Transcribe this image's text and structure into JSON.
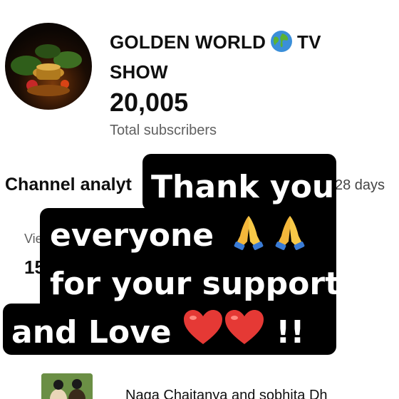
{
  "channel": {
    "name_part1": "GOLDEN WORLD",
    "name_part2": "TV",
    "name_line2": "SHOW",
    "subscriber_count": "20,005",
    "subscriber_label": "Total subscribers"
  },
  "analytics": {
    "title": "Channel analyt",
    "period": "28 days",
    "views_label": "Vie",
    "views_value": "15"
  },
  "video": {
    "title": "Naga Chaitanya and sobhita Dh"
  },
  "caption": {
    "line1": "Thank you",
    "line2": "everyone",
    "line3": "for your support",
    "line4_text": "and Love",
    "line4_end": "!!"
  },
  "icons": {
    "globe": "globe-icon",
    "pray": "folded-hands-icon",
    "heart": "red-heart-icon"
  },
  "colors": {
    "caption_bg": "#000000",
    "caption_text": "#ffffff",
    "secondary_text": "#606060"
  }
}
